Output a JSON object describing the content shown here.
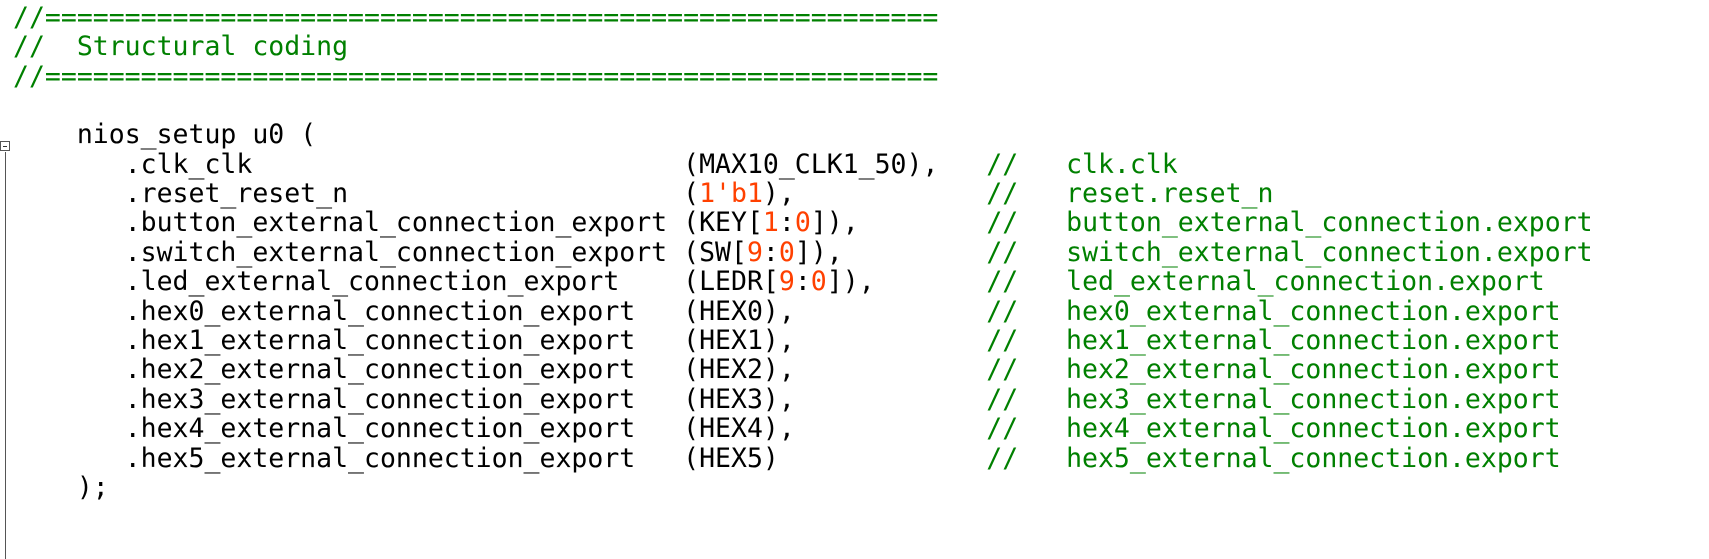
{
  "code": {
    "banner_top": "//========================================================",
    "banner_title": "//  Structural coding",
    "banner_bottom": "//========================================================",
    "instance_open": "nios_setup u0 (",
    "instance_close": ");",
    "ports": [
      {
        "name": ".clk_clk",
        "pad": "                           ",
        "open": "(",
        "arg": [
          {
            "t": "MAX10_CLK1_50"
          }
        ],
        "close": "),",
        "pad2": "   ",
        "comment": "//   clk.clk"
      },
      {
        "name": ".reset_reset_n",
        "pad": "                     ",
        "open": "(",
        "arg": [
          {
            "n": "1'b1"
          }
        ],
        "close": "),",
        "pad2": "            ",
        "comment": "//   reset.reset_n"
      },
      {
        "name": ".button_external_connection_export",
        "pad": " ",
        "open": "(",
        "arg": [
          {
            "t": "KEY["
          },
          {
            "n": "1"
          },
          {
            "t": ":"
          },
          {
            "n": "0"
          },
          {
            "t": "]"
          }
        ],
        "close": "),",
        "pad2": "        ",
        "comment": "//   button_external_connection.export"
      },
      {
        "name": ".switch_external_connection_export",
        "pad": " ",
        "open": "(",
        "arg": [
          {
            "t": "SW["
          },
          {
            "n": "9"
          },
          {
            "t": ":"
          },
          {
            "n": "0"
          },
          {
            "t": "]"
          }
        ],
        "close": "),",
        "pad2": "         ",
        "comment": "//   switch_external_connection.export"
      },
      {
        "name": ".led_external_connection_export",
        "pad": "    ",
        "open": "(",
        "arg": [
          {
            "t": "LEDR["
          },
          {
            "n": "9"
          },
          {
            "t": ":"
          },
          {
            "n": "0"
          },
          {
            "t": "]"
          }
        ],
        "close": "),",
        "pad2": "       ",
        "comment": "//   led_external_connection.export"
      },
      {
        "name": ".hex0_external_connection_export",
        "pad": "   ",
        "open": "(",
        "arg": [
          {
            "t": "HEX0"
          }
        ],
        "close": "),",
        "pad2": "            ",
        "comment": "//   hex0_external_connection.export"
      },
      {
        "name": ".hex1_external_connection_export",
        "pad": "   ",
        "open": "(",
        "arg": [
          {
            "t": "HEX1"
          }
        ],
        "close": "),",
        "pad2": "            ",
        "comment": "//   hex1_external_connection.export"
      },
      {
        "name": ".hex2_external_connection_export",
        "pad": "   ",
        "open": "(",
        "arg": [
          {
            "t": "HEX2"
          }
        ],
        "close": "),",
        "pad2": "            ",
        "comment": "//   hex2_external_connection.export"
      },
      {
        "name": ".hex3_external_connection_export",
        "pad": "   ",
        "open": "(",
        "arg": [
          {
            "t": "HEX3"
          }
        ],
        "close": "),",
        "pad2": "            ",
        "comment": "//   hex3_external_connection.export"
      },
      {
        "name": ".hex4_external_connection_export",
        "pad": "   ",
        "open": "(",
        "arg": [
          {
            "t": "HEX4"
          }
        ],
        "close": "),",
        "pad2": "            ",
        "comment": "//   hex4_external_connection.export"
      },
      {
        "name": ".hex5_external_connection_export",
        "pad": "   ",
        "open": "(",
        "arg": [
          {
            "t": "HEX5"
          }
        ],
        "close": ")",
        "pad2": "             ",
        "comment": "//   hex5_external_connection.export"
      }
    ]
  },
  "colors": {
    "comment": "#008000",
    "number": "#ff4000",
    "text": "#000000",
    "background": "#ffffff"
  },
  "icons": {
    "fold_marker": "collapse-box-icon"
  }
}
